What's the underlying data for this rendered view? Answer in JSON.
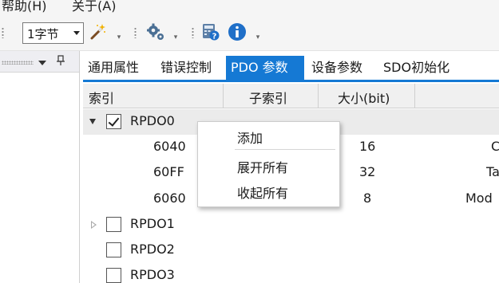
{
  "menu": {
    "help": "帮助(H)",
    "about": "关于(A)"
  },
  "toolbar": {
    "byte_size_selected": "1字节",
    "icons": [
      "wand-icon",
      "gear-icon",
      "calculator-help-icon",
      "info-icon"
    ]
  },
  "tabs": [
    {
      "label": "通用属性",
      "active": false
    },
    {
      "label": "错误控制",
      "active": false
    },
    {
      "label": "PDO 参数",
      "active": true
    },
    {
      "label": "设备参数",
      "active": false
    },
    {
      "label": "SDO初始化",
      "active": false
    }
  ],
  "columns": {
    "index": "索引",
    "subindex": "子索引",
    "size": "大小(bit)"
  },
  "rows": {
    "rpdo0": {
      "label": "RPDO0",
      "checked": true,
      "expanded": true
    },
    "entries": [
      {
        "index": "6040",
        "size": "16",
        "name": "C"
      },
      {
        "index": "60FF",
        "size": "32",
        "name": "Ta"
      },
      {
        "index": "6060",
        "size": "8",
        "name": "Mod"
      }
    ],
    "rpdo1": {
      "label": "RPDO1",
      "checked": false,
      "expanded": false
    },
    "rpdo2": {
      "label": "RPDO2",
      "checked": false
    },
    "rpdo3": {
      "label": "RPDO3",
      "checked": false
    }
  },
  "context_menu": {
    "add": "添加",
    "expand_all": "展开所有",
    "collapse_all": "收起所有"
  },
  "colors": {
    "accent": "#1579d4",
    "selected_row": "#ebebeb",
    "header_bg": "#f0f0f0"
  }
}
